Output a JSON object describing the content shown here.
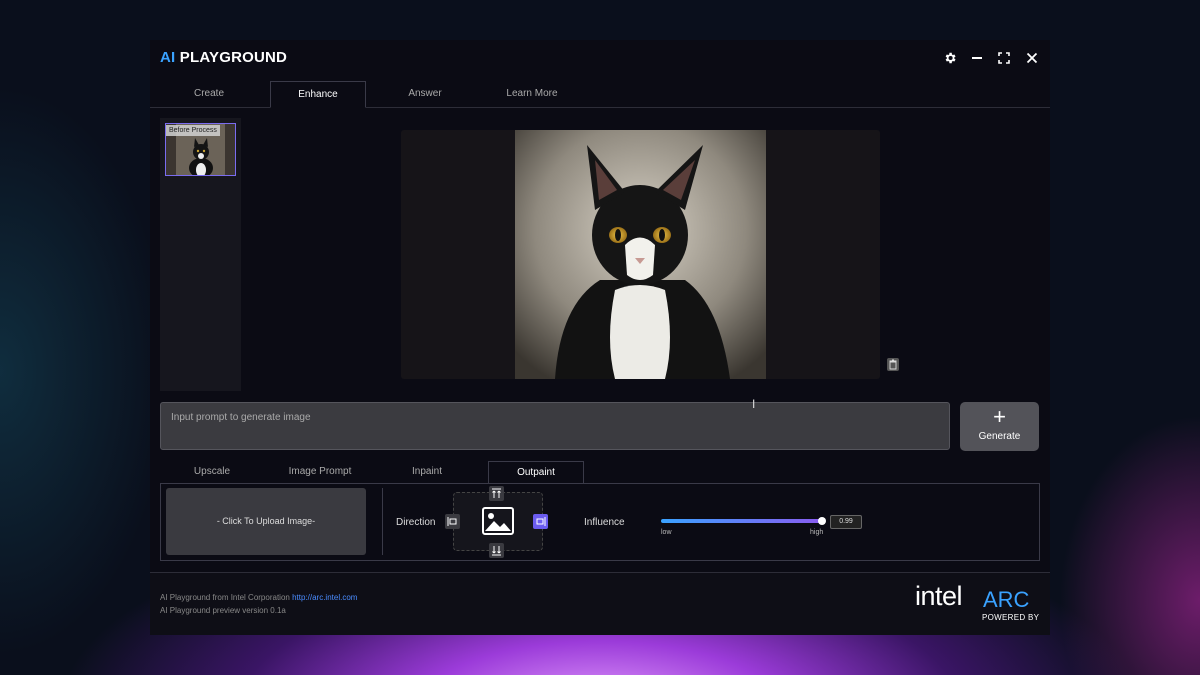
{
  "app": {
    "title_prefix": "AI",
    "title_rest": "PLAYGROUND"
  },
  "tabs": [
    {
      "label": "Create"
    },
    {
      "label": "Enhance"
    },
    {
      "label": "Answer"
    },
    {
      "label": "Learn More"
    }
  ],
  "active_tab": "Enhance",
  "history": {
    "thumb_label": "Before Process"
  },
  "prompt": {
    "placeholder": "Input prompt to generate image",
    "value": ""
  },
  "generate": {
    "icon": "+",
    "label": "Generate"
  },
  "subtabs": [
    {
      "label": "Upscale"
    },
    {
      "label": "Image Prompt"
    },
    {
      "label": "Inpaint"
    },
    {
      "label": "Outpaint"
    }
  ],
  "active_subtab": "Outpaint",
  "outpaint": {
    "upload_label": "- Click To Upload Image-",
    "direction_label": "Direction",
    "influence_label": "Influence",
    "influence_value": "0.99",
    "influence_fraction": 0.99,
    "low_label": "low",
    "high_label": "high"
  },
  "footer": {
    "line1_text": "AI Playground from Intel Corporation",
    "line1_link": "http://arc.intel.com",
    "line2_text": "AI Playground preview version 0.1a"
  },
  "branding": {
    "intel": "intel",
    "arc": "ARC",
    "powered_by": "POWERED BY"
  },
  "colors": {
    "accent_blue": "#3aa2ff",
    "accent_purple": "#6b5cf0",
    "window_bg": "#0b0b14"
  }
}
